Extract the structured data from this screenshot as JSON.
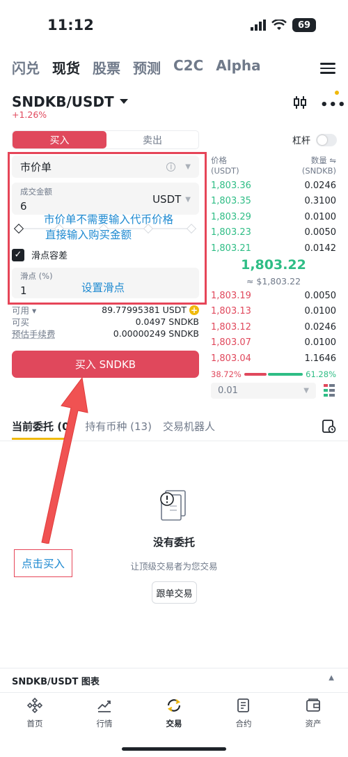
{
  "status": {
    "time": "11:12",
    "battery": "69"
  },
  "topnav": {
    "items": [
      "闪兑",
      "现货",
      "股票",
      "预测",
      "C2C",
      "Alpha"
    ],
    "active": "现货"
  },
  "pair": {
    "name": "SNDKB/USDT",
    "change": "+1.26%"
  },
  "trade_tabs": {
    "buy": "买入",
    "sell": "卖出"
  },
  "leverage_label": "杠杆",
  "order_type": "市价单",
  "amount": {
    "label": "成交金额",
    "value": "6",
    "unit": "USDT"
  },
  "slippage_tolerance_label": "滑点容差",
  "slippage": {
    "label": "滑点 (%)",
    "value": "1"
  },
  "annotations": {
    "market_line1": "市价单不需要输入代币价格",
    "market_line2": "直接输入购买金额",
    "slippage_note": "设置滑点",
    "click_buy": "点击买入"
  },
  "balances": [
    {
      "key": "可用",
      "value": "89.77995381 USDT"
    },
    {
      "key": "可买",
      "value": "0.0497 SNDKB"
    },
    {
      "key": "预估手续费",
      "value": "0.00000249 SNDKB"
    }
  ],
  "buy_button": "买入 SNDKB",
  "orderbook": {
    "price_label": "价格",
    "price_unit": "(USDT)",
    "qty_label": "数量",
    "qty_unit": "(SNDKB)",
    "asks": [
      {
        "price": "1,803.36",
        "qty": "0.0246",
        "depth": 0.29
      },
      {
        "price": "1,803.35",
        "qty": "0.3100",
        "depth": 0.28
      },
      {
        "price": "1,803.29",
        "qty": "0.0100",
        "depth": 0
      },
      {
        "price": "1,803.23",
        "qty": "0.0050",
        "depth": 0
      },
      {
        "price": "1,803.21",
        "qty": "0.0142",
        "depth": 0
      }
    ],
    "mid_price": "1,803.22",
    "mid_usd": "≈ $1,803.22",
    "bids": [
      {
        "price": "1,803.19",
        "qty": "0.0050",
        "depth": 0
      },
      {
        "price": "1,803.13",
        "qty": "0.0100",
        "depth": 0
      },
      {
        "price": "1,803.12",
        "qty": "0.0246",
        "depth": 0
      },
      {
        "price": "1,803.07",
        "qty": "0.0100",
        "depth": 0
      },
      {
        "price": "1,803.04",
        "qty": "1.1646",
        "depth": 1.0
      }
    ],
    "buy_ratio": "38.72%",
    "sell_ratio": "61.28%",
    "tick_size": "0.01"
  },
  "lower_tabs": [
    "当前委托 (0)",
    "持有币种 (13)",
    "交易机器人"
  ],
  "empty": {
    "title": "没有委托",
    "subtitle": "让顶级交易者为您交易",
    "button": "跟单交易"
  },
  "chart_bar": {
    "title": "SNDKB/USDT 图表"
  },
  "bottom_nav": [
    {
      "label": "首页",
      "icon": "home-icon"
    },
    {
      "label": "行情",
      "icon": "markets-icon"
    },
    {
      "label": "交易",
      "icon": "trade-icon"
    },
    {
      "label": "合约",
      "icon": "futures-icon"
    },
    {
      "label": "资产",
      "icon": "wallet-icon"
    }
  ],
  "colors": {
    "buy": "#e0485c",
    "up": "#2ebd85",
    "annotation": "#1f8ad1",
    "accent": "#f0b90b"
  }
}
